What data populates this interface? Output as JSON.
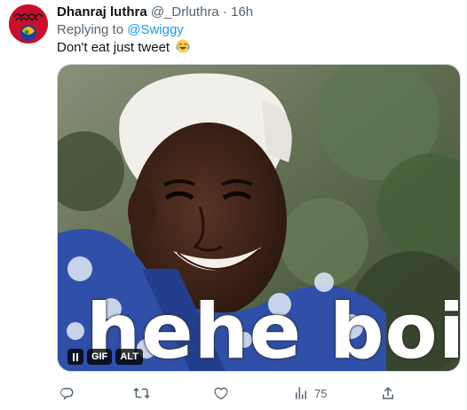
{
  "tweet": {
    "author_name": "Dhanraj luthra",
    "handle": "@_Drluthra",
    "separator": "·",
    "time": "16h",
    "replying_prefix": "Replying to",
    "replying_to": "@Swiggy",
    "text": "Don't eat just tweet",
    "emoji": "crying-laughing-face-icon"
  },
  "media": {
    "caption": "hehe boi",
    "badges": {
      "gif": "GIF",
      "alt": "ALT"
    }
  },
  "actions": {
    "views": "75",
    "icons": [
      "reply-icon",
      "retweet-icon",
      "like-icon",
      "views-icon",
      "share-icon"
    ]
  },
  "colors": {
    "link": "#1d9bf0",
    "muted": "#536471",
    "text": "#0f1419"
  }
}
